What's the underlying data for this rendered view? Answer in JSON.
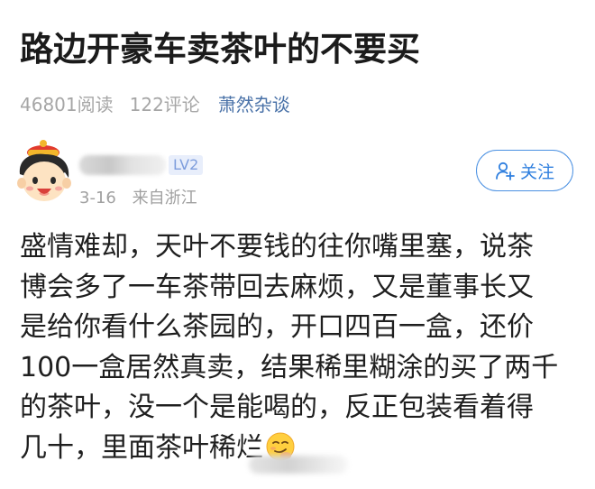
{
  "article": {
    "title": "路边开豪车卖茶叶的不要买",
    "read_count": "46801阅读",
    "comment_count": "122评论",
    "topic": "萧然杂谈"
  },
  "author": {
    "level": "LV2",
    "date": "3-16",
    "location": "来自浙江",
    "follow_label": "关注"
  },
  "post": {
    "lines": [
      "盛情难却，天叶不要钱的往你嘴里塞，说茶",
      "博会多了一车茶带回去麻烦，又是董事长又",
      "是给你看什么茶园的，开口四百一盒，还价",
      "100一盒居然真卖，结果稀里糊涂的买了两千",
      "的茶叶，没一个是能喝的，反正包装看着得",
      "几十，里面茶叶稀烂"
    ],
    "emoji": "smirk-emoji-icon"
  },
  "colors": {
    "accent_blue": "#2f7fdf",
    "topic_blue": "#4a72a8",
    "meta_gray": "#a6a6a6"
  }
}
